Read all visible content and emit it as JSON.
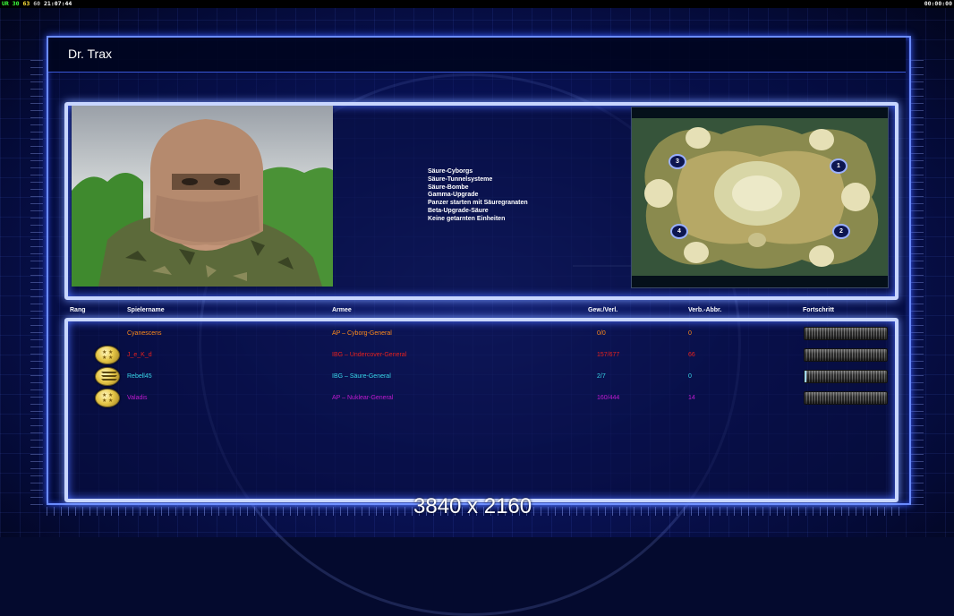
{
  "overlay": {
    "stats": [
      "UR",
      "30",
      "63",
      "60"
    ],
    "clock_left": "21:07:44",
    "clock_right": "00:00:00"
  },
  "window": {
    "title": "Dr. Trax"
  },
  "general": {
    "features": [
      "Säure-Cyborgs",
      "Säure-Tunnelsysteme",
      "Säure-Bombe",
      "Gamma-Upgrade",
      "Panzer starten mit Säuregranaten",
      "Beta-Upgrade-Säure",
      "Keine getarnten Einheiten"
    ]
  },
  "map": {
    "start_positions": [
      "1",
      "2",
      "3",
      "4"
    ]
  },
  "table": {
    "columns": {
      "rank": "Rang",
      "player": "Spielername",
      "army": "Armee",
      "winloss": "Gew./Verl.",
      "disconnects": "Verb.-Abbr.",
      "progress": "Fortschritt"
    },
    "rows": [
      {
        "player": "Cyanescens",
        "army": "AP – Cyborg-General",
        "winloss": "0/0",
        "disconnects": "0",
        "color": "#ff8a1a",
        "badge": "none",
        "progress": 0
      },
      {
        "player": "J_e_K_d",
        "army": "IBG – Undercover-General",
        "winloss": "157/677",
        "disconnects": "66",
        "color": "#e8201c",
        "badge": "stars",
        "progress": 0
      },
      {
        "player": "Rebell45",
        "army": "IBG – Säure-General",
        "winloss": "2/7",
        "disconnects": "0",
        "color": "#38d6e8",
        "badge": "chevrons",
        "progress": 0.02
      },
      {
        "player": "Valadis",
        "army": "AP – Nuklear-General",
        "winloss": "160/444",
        "disconnects": "14",
        "color": "#c01ad0",
        "badge": "stars",
        "progress": 0
      }
    ]
  },
  "watermark": "3840 x 2160"
}
